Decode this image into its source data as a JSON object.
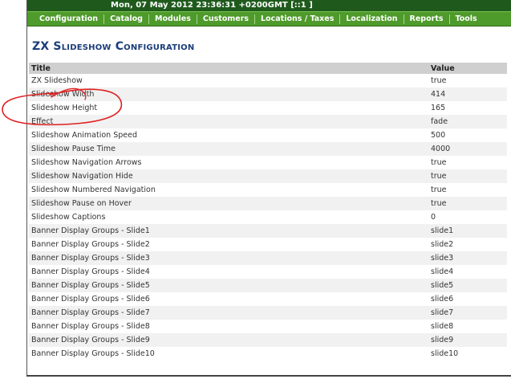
{
  "topbar": {
    "datetime": "Mon, 07 May 2012 23:36:31 +0200GMT [::1 ]"
  },
  "nav": [
    {
      "label": "Configuration"
    },
    {
      "label": "Catalog"
    },
    {
      "label": "Modules"
    },
    {
      "label": "Customers"
    },
    {
      "label": "Locations / Taxes"
    },
    {
      "label": "Localization"
    },
    {
      "label": "Reports"
    },
    {
      "label": "Tools"
    }
  ],
  "page": {
    "title": "ZX Slideshow Configuration"
  },
  "table": {
    "headers": {
      "title": "Title",
      "value": "Value"
    },
    "rows": [
      {
        "title": "ZX Slideshow",
        "value": "true"
      },
      {
        "title": "Slideshow Width",
        "value": "414"
      },
      {
        "title": "Slideshow Height",
        "value": "165"
      },
      {
        "title": "Effect",
        "value": "fade"
      },
      {
        "title": "Slideshow Animation Speed",
        "value": "500"
      },
      {
        "title": "Slideshow Pause Time",
        "value": "4000"
      },
      {
        "title": "Slideshow Navigation Arrows",
        "value": "true"
      },
      {
        "title": "Slideshow Navigation Hide",
        "value": "true"
      },
      {
        "title": "Slideshow Numbered Navigation",
        "value": "true"
      },
      {
        "title": "Slideshow Pause on Hover",
        "value": "true"
      },
      {
        "title": "Slideshow Captions",
        "value": "0"
      },
      {
        "title": "Banner Display Groups - Slide1",
        "value": "slide1"
      },
      {
        "title": "Banner Display Groups - Slide2",
        "value": "slide2"
      },
      {
        "title": "Banner Display Groups - Slide3",
        "value": "slide3"
      },
      {
        "title": "Banner Display Groups - Slide4",
        "value": "slide4"
      },
      {
        "title": "Banner Display Groups - Slide5",
        "value": "slide5"
      },
      {
        "title": "Banner Display Groups - Slide6",
        "value": "slide6"
      },
      {
        "title": "Banner Display Groups - Slide7",
        "value": "slide7"
      },
      {
        "title": "Banner Display Groups - Slide8",
        "value": "slide8"
      },
      {
        "title": "Banner Display Groups - Slide9",
        "value": "slide9"
      },
      {
        "title": "Banner Display Groups - Slide10",
        "value": "slide10"
      }
    ]
  },
  "colors": {
    "topbar_bg": "#1f5a1c",
    "nav_bg": "#4e9a2b",
    "title_color": "#1b3d7a",
    "header_bg": "#cfcfcf",
    "annotation_red": "#e02020"
  }
}
